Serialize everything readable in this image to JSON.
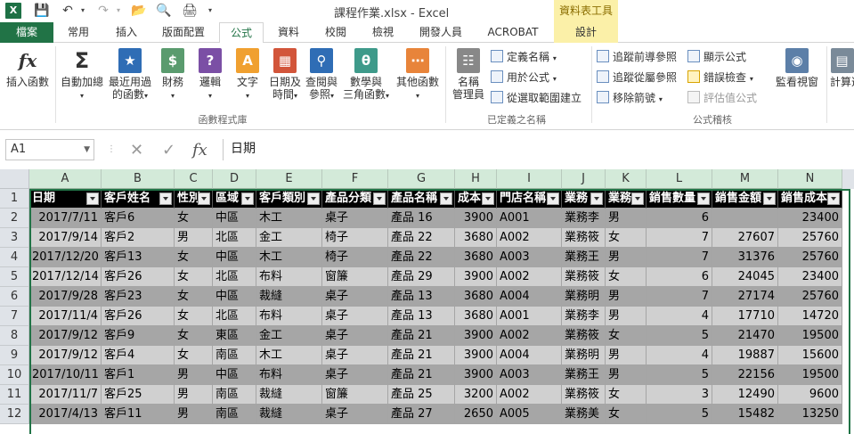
{
  "window": {
    "title": "課程作業.xlsx - Excel",
    "context_title": "資料表工具",
    "logo": "X"
  },
  "tabs": [
    {
      "label": "檔案"
    },
    {
      "label": "常用"
    },
    {
      "label": "插入"
    },
    {
      "label": "版面配置"
    },
    {
      "label": "公式"
    },
    {
      "label": "資料"
    },
    {
      "label": "校閱"
    },
    {
      "label": "檢視"
    },
    {
      "label": "開發人員"
    },
    {
      "label": "ACROBAT"
    },
    {
      "label": "設計"
    }
  ],
  "ribbon": {
    "library": {
      "insert_function": "插入函數",
      "autosum": "自動加總",
      "recent": "最近用過",
      "recent2": "的函數",
      "financial": "財務",
      "logical": "邏輯",
      "text": "文字",
      "datetime": "日期及",
      "datetime2": "時間",
      "lookup": "查閱與",
      "lookup2": "參照",
      "math": "數學與",
      "math2": "三角函數",
      "more": "其他函數",
      "group_label": "函數程式庫"
    },
    "names": {
      "name_manager": "名稱",
      "name_manager2": "管理員",
      "define_name": "定義名稱",
      "use_in_formula": "用於公式",
      "create_from_selection": "從選取範圍建立",
      "group_label": "已定義之名稱"
    },
    "auditing": {
      "trace_precedents": "追蹤前導參照",
      "trace_dependents": "追蹤從屬參照",
      "remove_arrows": "移除箭號",
      "show_formulas": "顯示公式",
      "error_checking": "錯誤檢查",
      "evaluate_formula": "評估值公式",
      "watch_window": "監看視窗",
      "group_label": "公式稽核"
    },
    "calculation": {
      "calc_options": "計算選"
    }
  },
  "formula_bar": {
    "name_box": "A1",
    "fx": "fx",
    "content": "日期"
  },
  "grid": {
    "columns": [
      "A",
      "B",
      "C",
      "D",
      "E",
      "F",
      "G",
      "H",
      "I",
      "J",
      "K",
      "L",
      "M",
      "N"
    ],
    "row_numbers": [
      "1",
      "2",
      "3",
      "4",
      "5",
      "6",
      "7",
      "8",
      "9",
      "10",
      "11",
      "12"
    ],
    "header": [
      "日期",
      "客戶姓名",
      "性別",
      "區域",
      "客戶類別",
      "產品分類",
      "產品名稱",
      "成本",
      "門店名稱",
      "業務",
      "業務",
      "銷售數量",
      "銷售金額",
      "銷售成本"
    ],
    "rows": [
      [
        "2017/7/11",
        "客戶6",
        "女",
        "中區",
        "木工",
        "桌子",
        "產品 16",
        "3900",
        "A001",
        "業務李",
        "男",
        "6",
        "",
        "23400"
      ],
      [
        "2017/9/14",
        "客戶2",
        "男",
        "北區",
        "金工",
        "椅子",
        "產品 22",
        "3680",
        "A002",
        "業務筱",
        "女",
        "7",
        "27607",
        "25760"
      ],
      [
        "2017/12/20",
        "客戶13",
        "女",
        "中區",
        "木工",
        "椅子",
        "產品 22",
        "3680",
        "A003",
        "業務王",
        "男",
        "7",
        "31376",
        "25760"
      ],
      [
        "2017/12/14",
        "客戶26",
        "女",
        "北區",
        "布料",
        "窗簾",
        "產品 29",
        "3900",
        "A002",
        "業務筱",
        "女",
        "6",
        "24045",
        "23400"
      ],
      [
        "2017/9/28",
        "客戶23",
        "女",
        "中區",
        "裁縫",
        "桌子",
        "產品 13",
        "3680",
        "A004",
        "業務明",
        "男",
        "7",
        "27174",
        "25760"
      ],
      [
        "2017/11/4",
        "客戶26",
        "女",
        "北區",
        "布料",
        "桌子",
        "產品 13",
        "3680",
        "A001",
        "業務李",
        "男",
        "4",
        "17710",
        "14720"
      ],
      [
        "2017/9/12",
        "客戶9",
        "女",
        "東區",
        "金工",
        "桌子",
        "產品 21",
        "3900",
        "A002",
        "業務筱",
        "女",
        "5",
        "21470",
        "19500"
      ],
      [
        "2017/9/12",
        "客戶4",
        "女",
        "南區",
        "木工",
        "桌子",
        "產品 21",
        "3900",
        "A004",
        "業務明",
        "男",
        "4",
        "19887",
        "15600"
      ],
      [
        "2017/10/11",
        "客戶1",
        "男",
        "中區",
        "布料",
        "桌子",
        "產品 21",
        "3900",
        "A003",
        "業務王",
        "男",
        "5",
        "22156",
        "19500"
      ],
      [
        "2017/11/7",
        "客戶25",
        "男",
        "南區",
        "裁縫",
        "窗簾",
        "產品 25",
        "3200",
        "A002",
        "業務筱",
        "女",
        "3",
        "12490",
        "9600"
      ],
      [
        "2017/4/13",
        "客戶11",
        "男",
        "南區",
        "裁縫",
        "桌子",
        "產品 27",
        "2650",
        "A005",
        "業務美",
        "女",
        "5",
        "15482",
        "13250"
      ]
    ]
  },
  "colors": {
    "excel_green": "#217346",
    "context_yellow": "#fbf0a8",
    "header_black": "#000000",
    "row_dark": "#a6a6a6",
    "row_light": "#d0d0d0"
  }
}
